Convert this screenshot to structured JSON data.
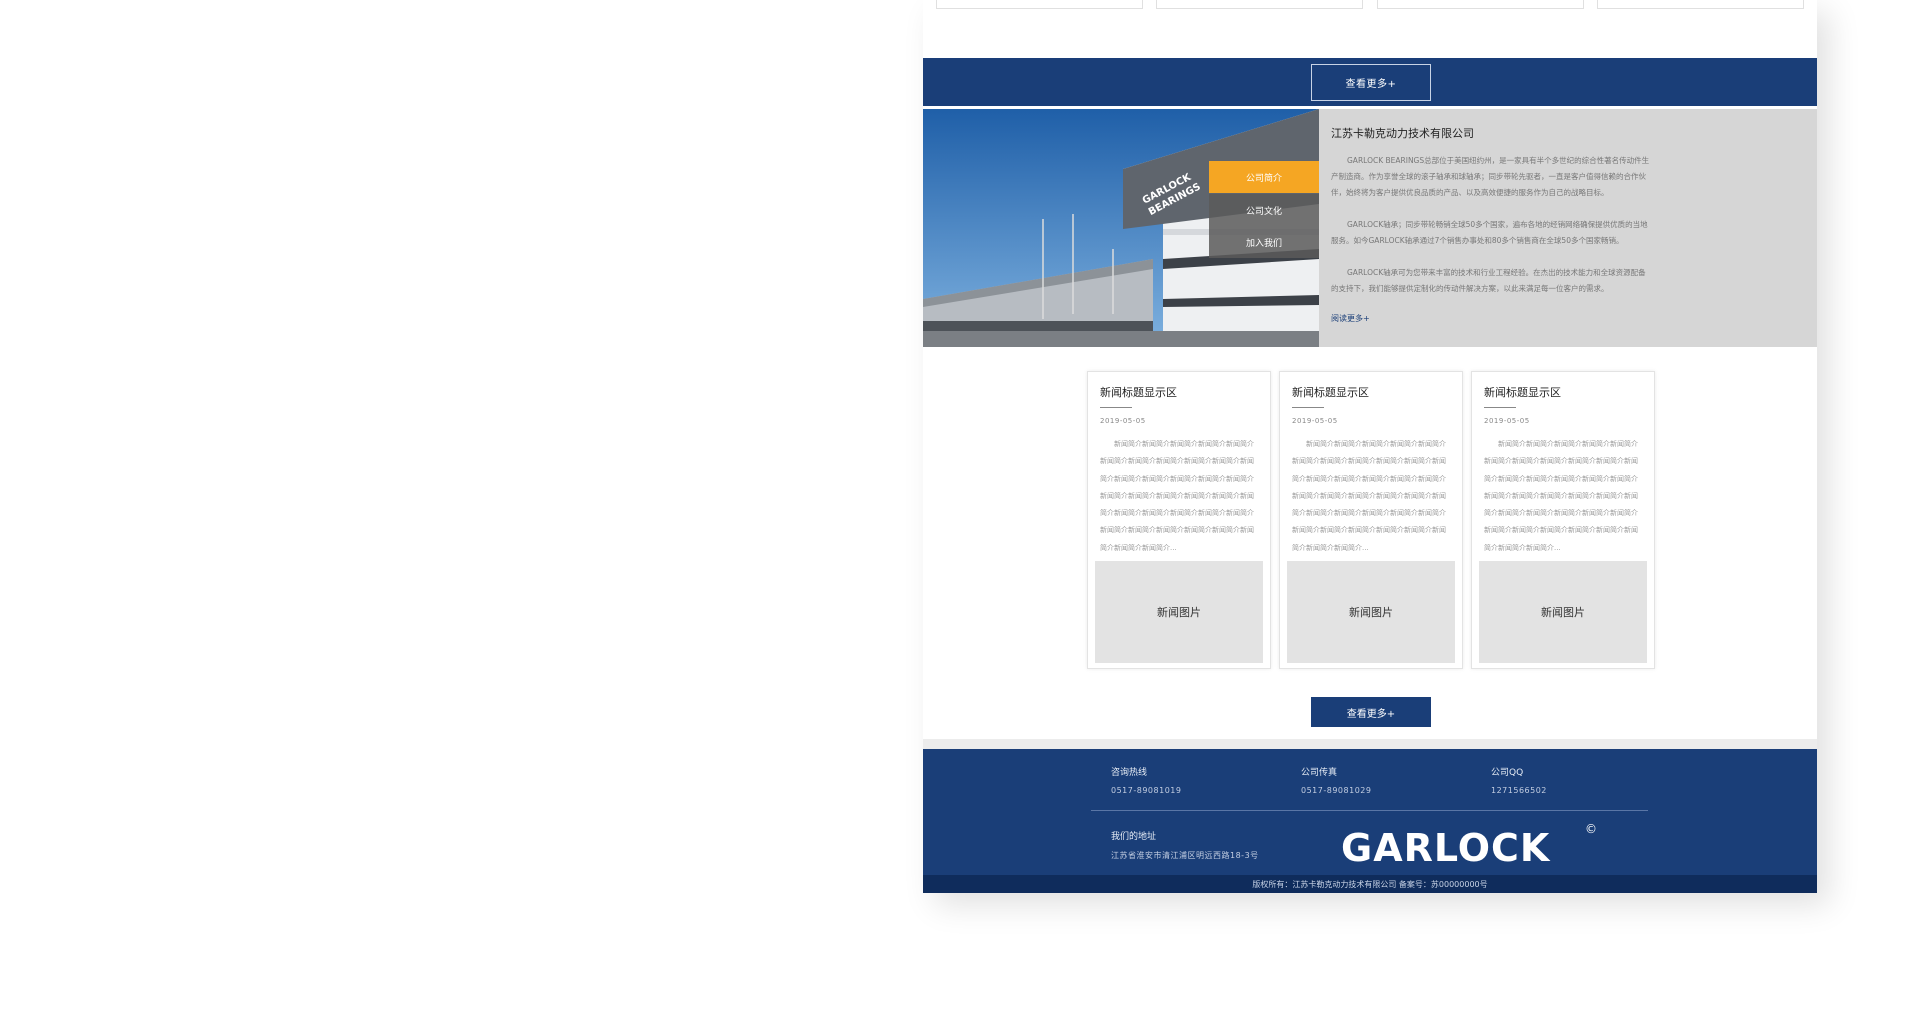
{
  "more_bar_top": {
    "label": "查看更多+"
  },
  "about": {
    "title": "江苏卡勒克动力技术有限公司",
    "paragraphs": [
      "GARLOCK    BEARINGS总部位于美国纽约州，是一家具有半个多世纪的综合性著名传动件生产制造商。作为享誉全球的滚子轴承和球轴承；同步带轮先驱者，一直是客户值得信赖的合作伙伴，始终将为客户提供优良品质的产品、以及高效便捷的服务作为自己的战略目标。",
      "GARLOCK轴承；同步带轮畅销全球50多个国家，遍布各地的经销网络确保提供优质的当地服务。如今GARLOCK轴承通过7个销售办事处和80多个销售商在全球50多个国家畅销。",
      "GARLOCK轴承可为您带来丰富的技术和行业工程经验。在杰出的技术能力和全球资源配备的支持下，我们能够提供定制化的传动件解决方案，以此来满足每一位客户的需求。"
    ],
    "read_more": "阅读更多+",
    "tabs": [
      "公司简介",
      "公司文化",
      "加入我们"
    ],
    "photo_sign": [
      "GARLOCK",
      "BEARINGS"
    ]
  },
  "news": [
    {
      "title": "新闻标题显示区",
      "date": "2019-05-05",
      "body": "新闻简介新闻简介新闻简介新闻简介新闻简介新闻简介新闻简介新闻简介新闻简介新闻简介新闻简介新闻简介新闻简介新闻简介新闻简介新闻简介新闻简介新闻简介新闻简介新闻简介新闻简介新闻简介新闻简介新闻简介新闻简介新闻简介新闻简介新闻简介新闻简介新闻简介新闻简介新闻简介新闻简介新闻简介新闻简介...",
      "image_label": "新闻图片"
    },
    {
      "title": "新闻标题显示区",
      "date": "2019-05-05",
      "body": "新闻简介新闻简介新闻简介新闻简介新闻简介新闻简介新闻简介新闻简介新闻简介新闻简介新闻简介新闻简介新闻简介新闻简介新闻简介新闻简介新闻简介新闻简介新闻简介新闻简介新闻简介新闻简介新闻简介新闻简介新闻简介新闻简介新闻简介新闻简介新闻简介新闻简介新闻简介新闻简介新闻简介新闻简介新闻简介...",
      "image_label": "新闻图片"
    },
    {
      "title": "新闻标题显示区",
      "date": "2019-05-05",
      "body": "新闻简介新闻简介新闻简介新闻简介新闻简介新闻简介新闻简介新闻简介新闻简介新闻简介新闻简介新闻简介新闻简介新闻简介新闻简介新闻简介新闻简介新闻简介新闻简介新闻简介新闻简介新闻简介新闻简介新闻简介新闻简介新闻简介新闻简介新闻简介新闻简介新闻简介新闻简介新闻简介新闻简介新闻简介新闻简介...",
      "image_label": "新闻图片"
    }
  ],
  "more_bottom": {
    "label": "查看更多+"
  },
  "footer": {
    "hotline_label": "咨询热线",
    "hotline_value": "0517-89081019",
    "fax_label": "公司传真",
    "fax_value": "0517-89081029",
    "qq_label": "公司QQ",
    "qq_value": "1271566502",
    "address_label": "我们的地址",
    "address_value": "江苏省淮安市清江浦区明远西路18-3号",
    "logo_text": "GARLOCK",
    "logo_mark": "©",
    "copyright": "版权所有：江苏卡勒克动力技术有限公司  备案号：苏00000000号"
  },
  "colors": {
    "brand_blue": "#1a3e78",
    "accent_orange": "#f5a623"
  }
}
